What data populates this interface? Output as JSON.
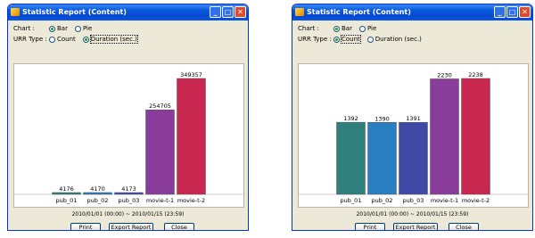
{
  "windows": [
    {
      "title": "Statistic Report (Content)",
      "title_buttons": [
        "minimize-icon",
        "maximize-icon",
        "close-icon"
      ],
      "chart_option_label": "Chart :",
      "chart_options": [
        {
          "label": "Bar",
          "selected": true
        },
        {
          "label": "Pie",
          "selected": false
        }
      ],
      "urr_type_label": "URR Type :",
      "urr_type_options": [
        {
          "label": "Count",
          "selected": false
        },
        {
          "label": "Duration (sec.)",
          "selected": true
        }
      ],
      "date_range": "2010/01/01 (00:00) ~ 2010/01/15 (23:59)",
      "buttons": [
        "Print",
        "Export Report",
        "Close"
      ],
      "chart_data": {
        "type": "bar",
        "categories": [
          "pub_01",
          "pub_02",
          "pub_03",
          "movie-t-1",
          "movie-t-2"
        ],
        "values": [
          4176,
          4170,
          4173,
          254705,
          349357
        ],
        "data_labels": [
          "4176",
          "4170",
          "4173",
          "254705",
          "349357"
        ],
        "colors": [
          "#2f7f7c",
          "#2a7fc0",
          "#3f4aa6",
          "#8a3c9b",
          "#c8284f"
        ],
        "ylim": [
          0,
          349357
        ],
        "grid": false
      }
    },
    {
      "title": "Statistic Report (Content)",
      "title_buttons": [
        "minimize-icon",
        "maximize-icon",
        "close-icon"
      ],
      "chart_option_label": "Chart :",
      "chart_options": [
        {
          "label": "Bar",
          "selected": true
        },
        {
          "label": "Pie",
          "selected": false
        }
      ],
      "urr_type_label": "URR Type :",
      "urr_type_options": [
        {
          "label": "Count",
          "selected": true
        },
        {
          "label": "Duration (sec.)",
          "selected": false
        }
      ],
      "date_range": "2010/01/01 (00:00) ~ 2010/01/15 (23:59)",
      "buttons": [
        "Print",
        "Export Report",
        "Close"
      ],
      "chart_data": {
        "type": "bar",
        "categories": [
          "pub_01",
          "pub_02",
          "pub_03",
          "movie-t-1",
          "movie-t-2"
        ],
        "values": [
          1392,
          1390,
          1391,
          2230,
          2238
        ],
        "data_labels": [
          "1392",
          "1390",
          "1391",
          "2230",
          "2238"
        ],
        "colors": [
          "#2f7f7c",
          "#2a7fc0",
          "#3f4aa6",
          "#8a3c9b",
          "#c8284f"
        ],
        "ylim": [
          0,
          2238
        ],
        "grid": false
      }
    }
  ]
}
